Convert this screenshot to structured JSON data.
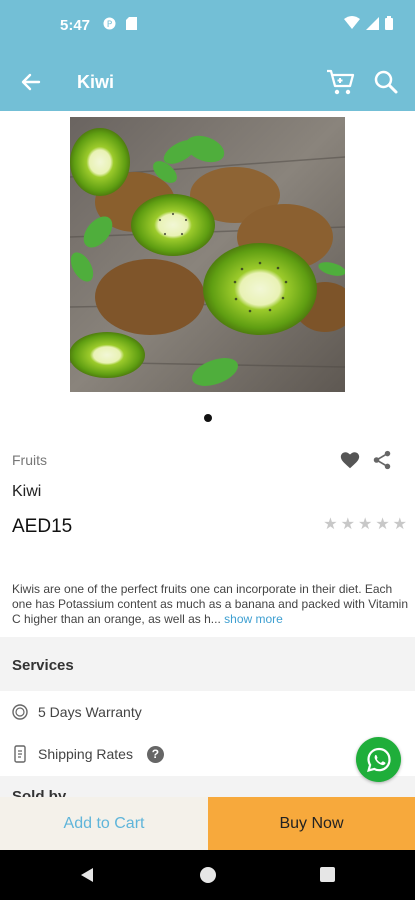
{
  "status_bar": {
    "time": "5:47"
  },
  "app_bar": {
    "title": "Kiwi"
  },
  "product": {
    "category": "Fruits",
    "name": "Kiwi",
    "price": "AED15",
    "rating_stars_filled": 0,
    "rating_stars_total": 5,
    "description": "Kiwis are one of the perfect fruits one can incorporate in their diet. Each one has Potassium content as much as a banana and packed with Vitamin C higher than an orange, as well as h...",
    "show_more": "show more"
  },
  "services": {
    "title": "Services",
    "items": [
      {
        "label": "5 Days Warranty",
        "icon": "warranty-badge-icon"
      },
      {
        "label": "Shipping Rates",
        "icon": "receipt-icon"
      }
    ],
    "help_icon": "?"
  },
  "sold_by": {
    "title": "Sold by"
  },
  "actions": {
    "add_to_cart": "Add to Cart",
    "buy_now": "Buy Now"
  },
  "colors": {
    "header": "#73bfd6",
    "buy_now": "#f7a93c",
    "add_to_cart_bg": "#f4f1ea",
    "accent_text": "#5fb5da",
    "whatsapp": "#1fae3a"
  }
}
